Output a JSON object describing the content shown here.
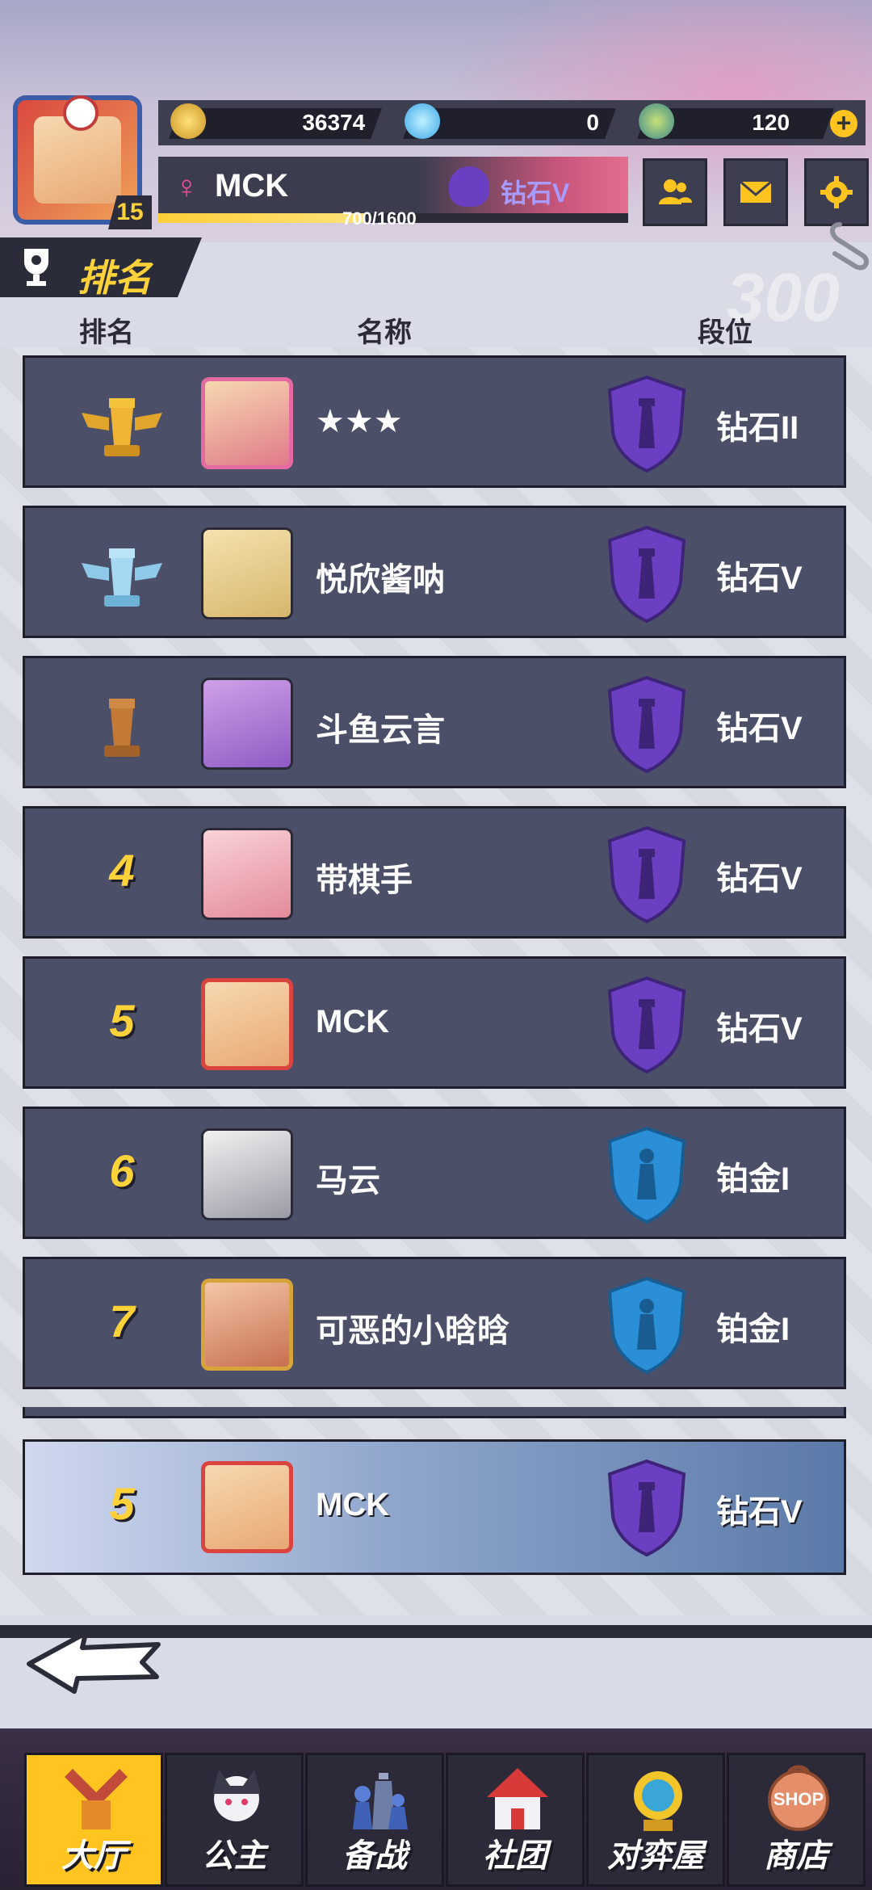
{
  "header": {
    "level": "15",
    "currencies": [
      {
        "icon": "gold-coin-icon",
        "value": "36374"
      },
      {
        "icon": "diamond-icon",
        "value": "0"
      },
      {
        "icon": "stamina-icon",
        "value": "120"
      }
    ],
    "player_name": "MCK",
    "player_rank": "钻石V",
    "exp_text": "700/1600",
    "exp_fraction": 0.4375,
    "buttons": [
      "friends-icon",
      "mail-icon",
      "settings-icon"
    ]
  },
  "ranking": {
    "title": "排名",
    "watermark": "300",
    "columns": {
      "rank": "排名",
      "name": "名称",
      "tier": "段位"
    },
    "rows": [
      {
        "rank": "1",
        "name": "★★★",
        "tier": "钻石II",
        "tier_color": "#6b3fc2"
      },
      {
        "rank": "2",
        "name": "悦欣酱呐",
        "tier": "钻石V",
        "tier_color": "#6b3fc2"
      },
      {
        "rank": "3",
        "name": "斗鱼云言",
        "tier": "钻石V",
        "tier_color": "#6b3fc2"
      },
      {
        "rank": "4",
        "name": "带棋手",
        "tier": "钻石V",
        "tier_color": "#6b3fc2"
      },
      {
        "rank": "5",
        "name": "MCK",
        "tier": "钻石V",
        "tier_color": "#6b3fc2"
      },
      {
        "rank": "6",
        "name": "马云",
        "tier": "铂金I",
        "tier_color": "#2a8fd6"
      },
      {
        "rank": "7",
        "name": "可恶的小晗晗",
        "tier": "铂金I",
        "tier_color": "#2a8fd6"
      }
    ],
    "self_row": {
      "rank": "5",
      "name": "MCK",
      "tier": "钻石V"
    }
  },
  "nav": {
    "items": [
      {
        "label": "大厅",
        "icon": "lobby-icon",
        "active": true
      },
      {
        "label": "公主",
        "icon": "princess-icon",
        "active": false
      },
      {
        "label": "备战",
        "icon": "chess-pieces-icon",
        "active": false
      },
      {
        "label": "社团",
        "icon": "club-icon",
        "active": false
      },
      {
        "label": "对弈屋",
        "icon": "battle-house-icon",
        "active": false
      },
      {
        "label": "商店",
        "icon": "shop-icon",
        "active": false
      }
    ],
    "shop_badge": "SHOP"
  },
  "colors": {
    "accent": "#ffd23a",
    "row_bg": "#4b4f67",
    "diamond_tier": "#6b3fc2",
    "platinum_tier": "#2a8fd6"
  }
}
